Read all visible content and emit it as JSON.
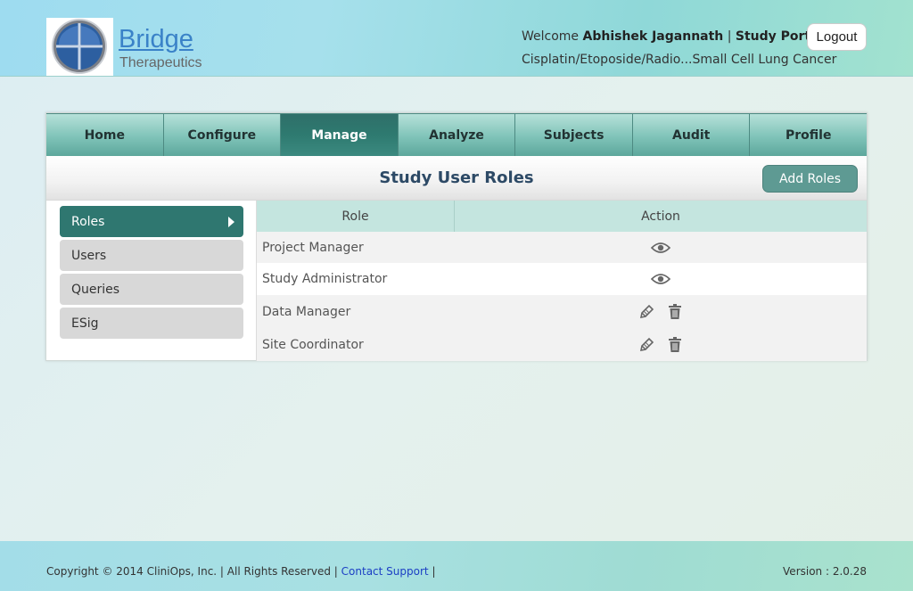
{
  "header": {
    "logo_title": "Bridge",
    "logo_subtitle": "Therapeutics",
    "welcome_prefix": "Welcome",
    "user_name": "Abhishek Jagannath",
    "separator": "|",
    "portal": "Study Portal",
    "study_name": "Cisplatin/Etoposide/Radio...Small Cell Lung Cancer",
    "logout_label": "Logout"
  },
  "nav": {
    "items": [
      {
        "label": "Home"
      },
      {
        "label": "Configure"
      },
      {
        "label": "Manage"
      },
      {
        "label": "Analyze"
      },
      {
        "label": "Subjects"
      },
      {
        "label": "Audit"
      },
      {
        "label": "Profile"
      }
    ],
    "active": "Manage"
  },
  "page": {
    "title": "Study User Roles",
    "add_button": "Add Roles"
  },
  "sidebar": {
    "items": [
      {
        "label": "Roles"
      },
      {
        "label": "Users"
      },
      {
        "label": "Queries"
      },
      {
        "label": "ESig"
      }
    ],
    "active": "Roles"
  },
  "table": {
    "columns": [
      "Role",
      "Action"
    ],
    "rows": [
      {
        "role": "Project Manager",
        "actions": [
          "eye-icon"
        ]
      },
      {
        "role": "Study Administrator",
        "actions": [
          "eye-icon"
        ]
      },
      {
        "role": "Data Manager",
        "actions": [
          "pencil-icon",
          "trash-icon"
        ]
      },
      {
        "role": "Site Coordinator",
        "actions": [
          "pencil-icon",
          "trash-icon"
        ]
      }
    ]
  },
  "footer": {
    "copyright": "Copyright © 2014 CliniOps, Inc. | All Rights Reserved |",
    "contact_link": "Contact Support",
    "trailing_separator": "|",
    "version": "Version : 2.0.28"
  },
  "colors": {
    "nav_active": "#2e7a70",
    "sidebar_active": "#2f7770",
    "add_button": "#5e9a93",
    "title_text": "#2d4a66",
    "link": "#1c3fc4"
  }
}
